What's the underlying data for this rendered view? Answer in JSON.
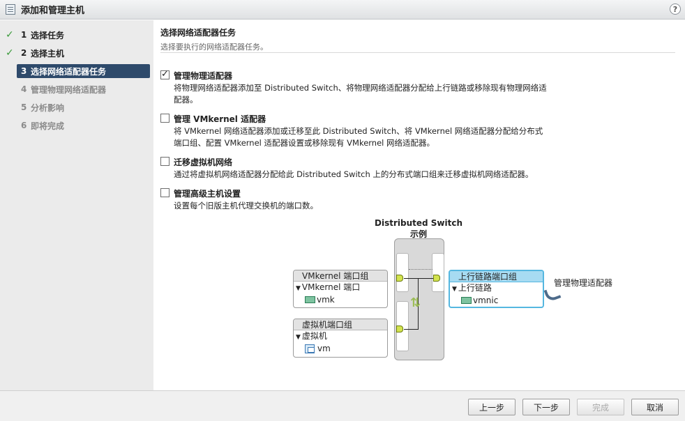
{
  "window": {
    "title": "添加和管理主机",
    "help_label": "?"
  },
  "nav": {
    "items": [
      {
        "num": "1",
        "label": "选择任务",
        "state": "done"
      },
      {
        "num": "2",
        "label": "选择主机",
        "state": "done"
      },
      {
        "num": "3",
        "label": "选择网络适配器任务",
        "state": "active"
      },
      {
        "num": "4",
        "label": "管理物理网络适配器",
        "state": "pending"
      },
      {
        "num": "5",
        "label": "分析影响",
        "state": "pending"
      },
      {
        "num": "6",
        "label": "即将完成",
        "state": "pending"
      }
    ]
  },
  "header": {
    "title": "选择网络适配器任务",
    "subtitle": "选择要执行的网络适配器任务。"
  },
  "options": [
    {
      "checked": true,
      "label": "管理物理适配器",
      "desc": "将物理网络适配器添加至 Distributed Switch、将物理网络适配器分配给上行链路或移除现有物理网络适配器。"
    },
    {
      "checked": false,
      "label": "管理 VMkernel 适配器",
      "desc": "将 VMkernel 网络适配器添加或迁移至此 Distributed Switch、将 VMkernel 网络适配器分配给分布式端口组、配置 VMkernel 适配器设置或移除现有 VMkernel 网络适配器。"
    },
    {
      "checked": false,
      "label": "迁移虚拟机网络",
      "desc": "通过将虚拟机网络适配器分配给此 Distributed Switch 上的分布式端口组来迁移虚拟机网络适配器。"
    },
    {
      "checked": false,
      "label": "管理高级主机设置",
      "desc": "设置每个旧版主机代理交换机的端口数。"
    }
  ],
  "diagram": {
    "title": "Distributed Switch 示例",
    "vmkernel_group": {
      "head": "VMkernel 端口组",
      "row": "VMkernel 端口",
      "item": "vmk"
    },
    "vm_group": {
      "head": "虚拟机端口组",
      "row": "虚拟机",
      "item": "vm"
    },
    "uplink_group": {
      "head": "上行链路端口组",
      "row": "上行链路",
      "item": "vmnic"
    },
    "annotation": "管理物理适配器"
  },
  "footer": {
    "back": "上一步",
    "next": "下一步",
    "finish": "完成",
    "cancel": "取消"
  }
}
